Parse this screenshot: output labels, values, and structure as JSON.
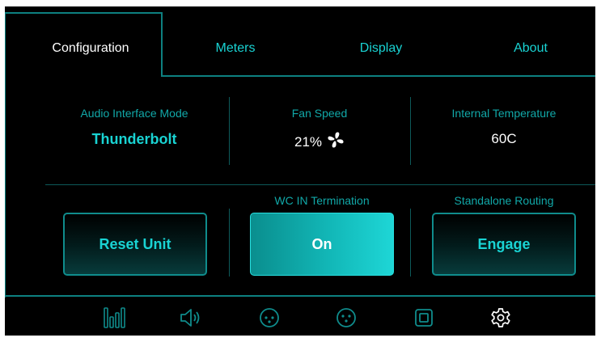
{
  "tabs": {
    "configuration": "Configuration",
    "meters": "Meters",
    "display": "Display",
    "about": "About"
  },
  "status": {
    "audio_interface_mode_label": "Audio Interface Mode",
    "audio_interface_mode_value": "Thunderbolt",
    "fan_speed_label": "Fan Speed",
    "fan_speed_value": "21%",
    "internal_temperature_label": "Internal Temperature",
    "internal_temperature_value": "60C"
  },
  "controls": {
    "reset_label": "Reset Unit",
    "wc_termination_label": "WC IN Termination",
    "wc_termination_value": "On",
    "standalone_routing_label": "Standalone Routing",
    "standalone_routing_value": "Engage"
  },
  "bottom_bar": {
    "icons": [
      "meters-icon",
      "speaker-icon",
      "xlr-input-icon",
      "xlr-output-icon",
      "square-icon",
      "settings-icon"
    ]
  },
  "colors": {
    "accent": "#19d3d3",
    "border": "#0d8080",
    "background": "#000000",
    "text_primary": "#ffffff"
  }
}
